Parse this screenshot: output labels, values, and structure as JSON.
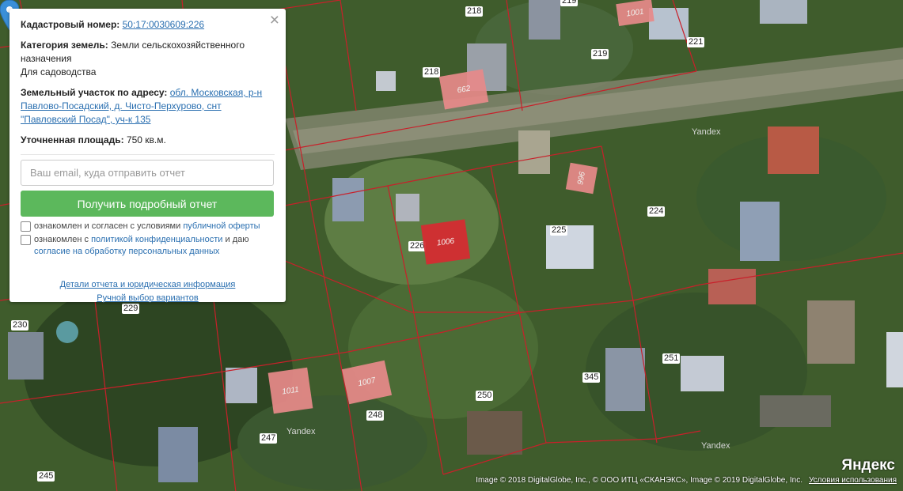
{
  "panel": {
    "cadastral_label": "Кадастровый номер:",
    "cadastral_number": "50:17:0030609:226",
    "category_label": "Категория земель:",
    "category_value": "Земли сельскохозяйственного назначения",
    "usage_value": "Для садоводства",
    "address_label": "Земельный участок по адресу:",
    "address_value": "обл. Московская, р-н Павлово-Посадский, д. Чисто-Перхурово, снт \"Павловский Посад\", уч-к 135",
    "area_label": "Уточненная площадь:",
    "area_value": "750 кв.м.",
    "email_placeholder": "Ваш email, куда отправить отчет",
    "submit_label": "Получить подробный отчет",
    "check1_prefix": "ознакомлен и согласен с условиями",
    "check1_link": "публичной оферты",
    "check2_prefix": "ознакомлен с",
    "check2_link": "политикой конфиденциальности",
    "check2_mid": "и даю",
    "check2_link2": "согласие на обработку персональных данных",
    "details_link": "Детали отчета и юридическая информация",
    "manual_link": "Ручной выбор вариантов",
    "close_glyph": "×"
  },
  "map": {
    "parcel_numbers": [
      "218",
      "219",
      "221",
      "218",
      "219",
      "224",
      "225",
      "226",
      "229",
      "230",
      "250",
      "251",
      "345",
      "248",
      "247",
      "245"
    ],
    "buildings": [
      "1001",
      "662",
      "996",
      "1006",
      "1011",
      "1007"
    ],
    "watermarks": [
      "Yandex",
      "Yandex",
      "Yandex"
    ],
    "logo": "Яндекс",
    "attribution": "Image © 2018 DigitalGlobe, Inc., © ООО ИТЦ «СКАНЭКС», Image © 2019 DigitalGlobe, Inc.",
    "terms": "Условия использования",
    "colors": {
      "boundary": "#c8202a",
      "building": "#e88a8a",
      "selected": "#d42c32",
      "pin": "#3a8fd8",
      "button": "#5cb85c"
    }
  }
}
